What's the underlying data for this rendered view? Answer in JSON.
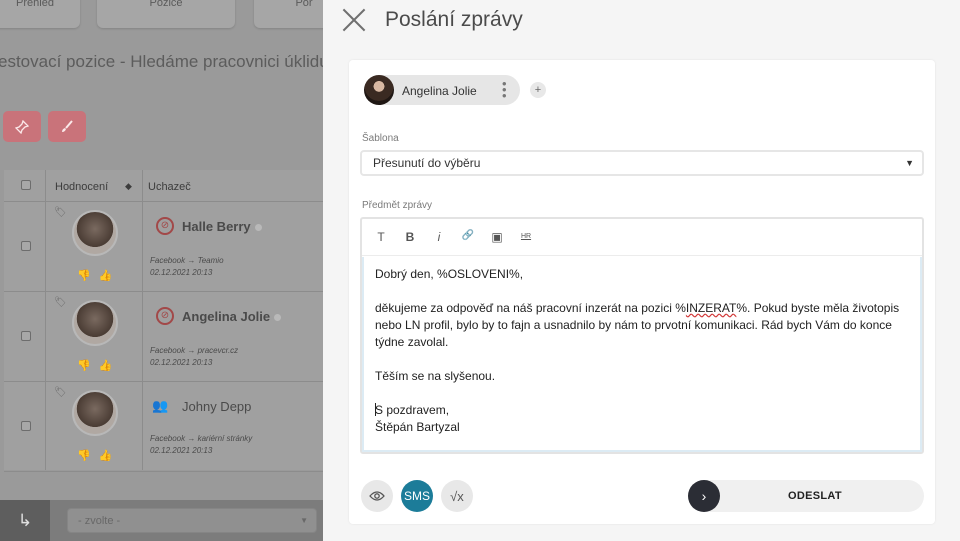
{
  "background": {
    "tabs": [
      "Přehled",
      "Pozice",
      "Poř"
    ],
    "title": "estovací pozice - Hledáme pracovnici úklidu",
    "table": {
      "headers": {
        "rating": "Hodnocení",
        "candidate": "Uchazeč"
      },
      "rows": [
        {
          "name": "Halle Berry",
          "source": "Facebook → Teamio",
          "date": "02.12.2021 20:13"
        },
        {
          "name": "Angelina Jolie",
          "source": "Facebook → pracevcr.cz",
          "date": "02.12.2021 20:13"
        },
        {
          "name": "Johny Depp",
          "source": "Facebook → kariérní stránky",
          "date": "02.12.2021 20:13"
        }
      ]
    },
    "footer": {
      "select_value": "- zvolte -"
    }
  },
  "modal": {
    "title": "Poslání zprávy",
    "recipient": {
      "name": "Angelina Jolie",
      "add_label": "+"
    },
    "template": {
      "label": "Šablona",
      "value": "Přesunutí do výběru"
    },
    "subject": {
      "label": "Předmět zprávy"
    },
    "toolbar": {
      "text": "T",
      "bold": "B",
      "italic": "i",
      "link": "🔗",
      "image": "▣",
      "hr": "HR"
    },
    "body": {
      "greeting": "Dobrý den, %OSLOVENI%,",
      "para1_start": "děkujeme za odpověď na náš pracovní inzerát na pozici %",
      "para1_misspelled": "INZERAT",
      "para1_end": "%. Pokud byste měla životopis nebo LN profil, bylo by to fajn a usnadnilo by nám to prvotní komunikaci. Rád bych Vám do konce týdne zavolal.",
      "closing": "Těším se na slyšenou.",
      "signoff": "S pozdravem,",
      "signature": "Štěpán Bartyzal"
    },
    "actions": {
      "sms_label": "SMS",
      "formula_label": "√x",
      "send_label": "ODESLAT"
    }
  },
  "colors": {
    "sms_button": "#1c7c99",
    "send_circle": "#2b2d35",
    "bg_accent_button": "#c9737a"
  }
}
